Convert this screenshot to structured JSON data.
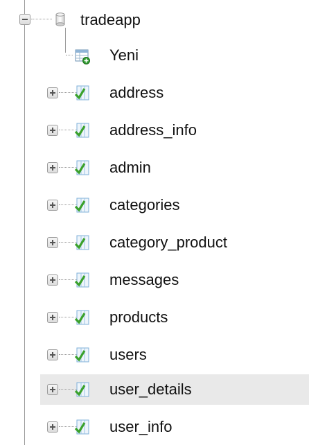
{
  "database": {
    "name": "tradeapp",
    "expanded": true
  },
  "new_item": {
    "label": "Yeni"
  },
  "tables": [
    {
      "label": "address"
    },
    {
      "label": "address_info"
    },
    {
      "label": "admin"
    },
    {
      "label": "categories"
    },
    {
      "label": "category_product"
    },
    {
      "label": "messages"
    },
    {
      "label": "products"
    },
    {
      "label": "users"
    },
    {
      "label": "user_details",
      "highlighted": true
    },
    {
      "label": "user_info"
    }
  ],
  "colors": {
    "highlight": "#e9e9e9",
    "text": "#111111",
    "tree_line": "#9a9a9a",
    "table_icon_green": "#33a02c",
    "table_icon_blue": "#6aa6d8"
  },
  "icons": {
    "expander_collapsed": "plus-icon",
    "expander_expanded": "minus-icon",
    "database": "database-icon",
    "table": "table-icon",
    "new": "new-table-icon"
  }
}
